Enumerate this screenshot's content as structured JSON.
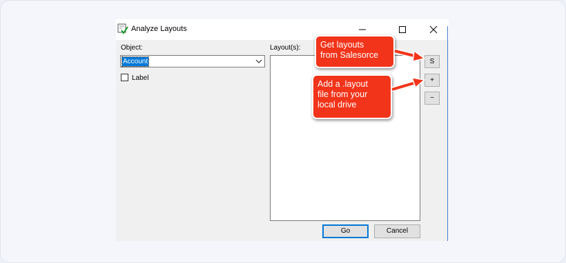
{
  "window": {
    "title": "Analyze Layouts",
    "icons": {
      "app": "checklist-icon",
      "minimize": "minimize-icon",
      "maximize": "maximize-icon",
      "close": "close-icon"
    }
  },
  "form": {
    "object_label": "Object:",
    "object_value": "Account",
    "label_checkbox": "Label",
    "label_checked": false,
    "layouts_label": "Layout(s):",
    "layouts": []
  },
  "side_buttons": {
    "salesforce": "S",
    "add": "+",
    "remove": "−"
  },
  "footer": {
    "go": "Go",
    "cancel": "Cancel"
  },
  "annotations": {
    "callout_1_line_1": "Get layouts",
    "callout_1_line_2": "from Salesorce",
    "callout_2_line_1": "Add a .layout",
    "callout_2_line_2": "file from your",
    "callout_2_line_3": "local drive",
    "color": "#f2341a"
  }
}
